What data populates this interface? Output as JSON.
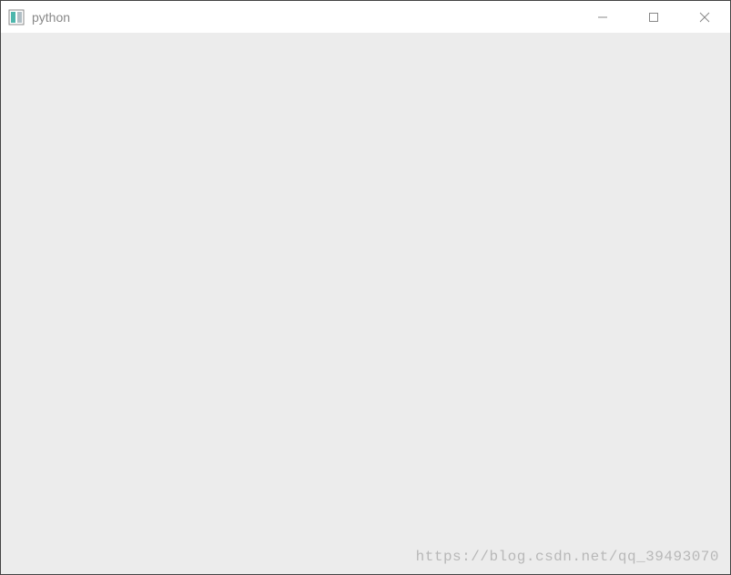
{
  "window": {
    "title": "python"
  },
  "watermark": {
    "text": "https://blog.csdn.net/qq_39493070"
  }
}
